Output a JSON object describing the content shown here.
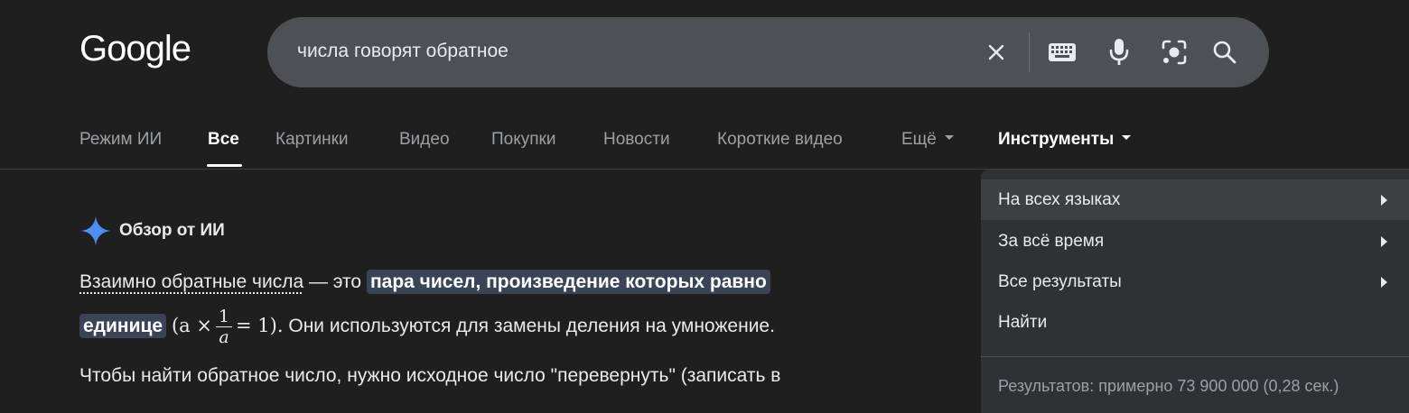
{
  "logo": "Google",
  "search": {
    "query": "числа говорят обратное"
  },
  "icons": {
    "clear": "close-icon",
    "keyboard": "keyboard-icon",
    "mic": "microphone-icon",
    "lens": "lens-icon",
    "search": "search-icon"
  },
  "tabs": [
    {
      "label": "Режим ИИ"
    },
    {
      "label": "Все"
    },
    {
      "label": "Картинки"
    },
    {
      "label": "Видео"
    },
    {
      "label": "Покупки"
    },
    {
      "label": "Новости"
    },
    {
      "label": "Короткие видео"
    },
    {
      "label": "Ещё"
    },
    {
      "label": "Инструменты"
    }
  ],
  "ai_overview": {
    "title": "Обзор от ИИ",
    "line1_link": "Взаимно обратные числа",
    "line1_text": " — это ",
    "line1_highlight": "пара чисел, произведение которых равно",
    "line2_highlight": "единице",
    "math_open": "(a ×",
    "frac_num": "1",
    "frac_den": "a",
    "math_close": "= 1).",
    "line2_text": " Они используются для замены деления на умножение.",
    "line3_text": "Чтобы найти обратное число, нужно исходное число \"перевернуть\" (записать в"
  },
  "tools_menu": {
    "items": [
      {
        "label": "На всех языках"
      },
      {
        "label": "За всё время"
      },
      {
        "label": "Все результаты"
      },
      {
        "label": "Найти"
      }
    ],
    "stats": "Результатов: примерно 73 900 000 (0,28 сек.)"
  },
  "colors": {
    "background": "#1f1f1f",
    "searchbox": "#4d5156",
    "highlight": "#394457",
    "menu": "#303134",
    "sparkle": "#4c8df6"
  }
}
